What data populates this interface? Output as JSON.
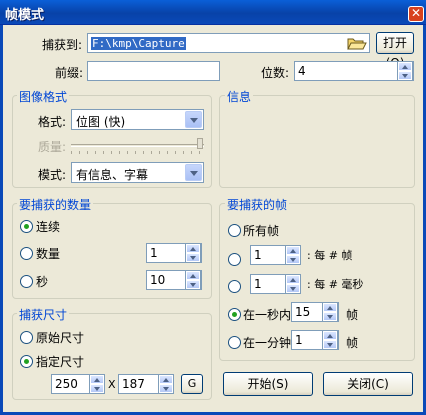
{
  "window": {
    "title": "帧模式",
    "close_glyph": "✕"
  },
  "capture_to": {
    "label": "捕获到:",
    "path": "F:\\kmp\\Capture",
    "open_label": "打开(O)",
    "folder_icon": "folder-icon"
  },
  "prefix": {
    "label": "前缀:",
    "value": ""
  },
  "digits": {
    "label": "位数:",
    "value": "4"
  },
  "image_format": {
    "title": "图像格式",
    "format_label": "格式:",
    "format_value": "位图 (快)",
    "quality_label": "质量:",
    "mode_label": "模式:",
    "mode_value": "有信息、字幕"
  },
  "info": {
    "title": "信息"
  },
  "capture_count": {
    "title": "要捕获的数量",
    "continuous": "连续",
    "count_label": "数量",
    "count_value": "1",
    "seconds_label": "秒",
    "seconds_value": "10",
    "selected": "continuous"
  },
  "frames_to_capture": {
    "title": "要捕获的帧",
    "all_frames": "所有帧",
    "every_frames_value": "1",
    "every_frames_label": ": 每 # 帧",
    "every_ms_value": "1",
    "every_ms_label": ": 每 # 毫秒",
    "in_second_label": "在一秒内",
    "in_second_value": "15",
    "in_second_unit": "帧",
    "in_minute_label": "在一分钟",
    "in_minute_value": "1",
    "in_minute_unit": "帧",
    "selected": "in_second"
  },
  "capture_size": {
    "title": "捕获尺寸",
    "original": "原始尺寸",
    "specified": "指定尺寸",
    "width": "250",
    "x_label": "X",
    "height": "187",
    "g_button": "G",
    "selected": "specified"
  },
  "buttons": {
    "start": "开始(S)",
    "close": "关闭(C)"
  }
}
